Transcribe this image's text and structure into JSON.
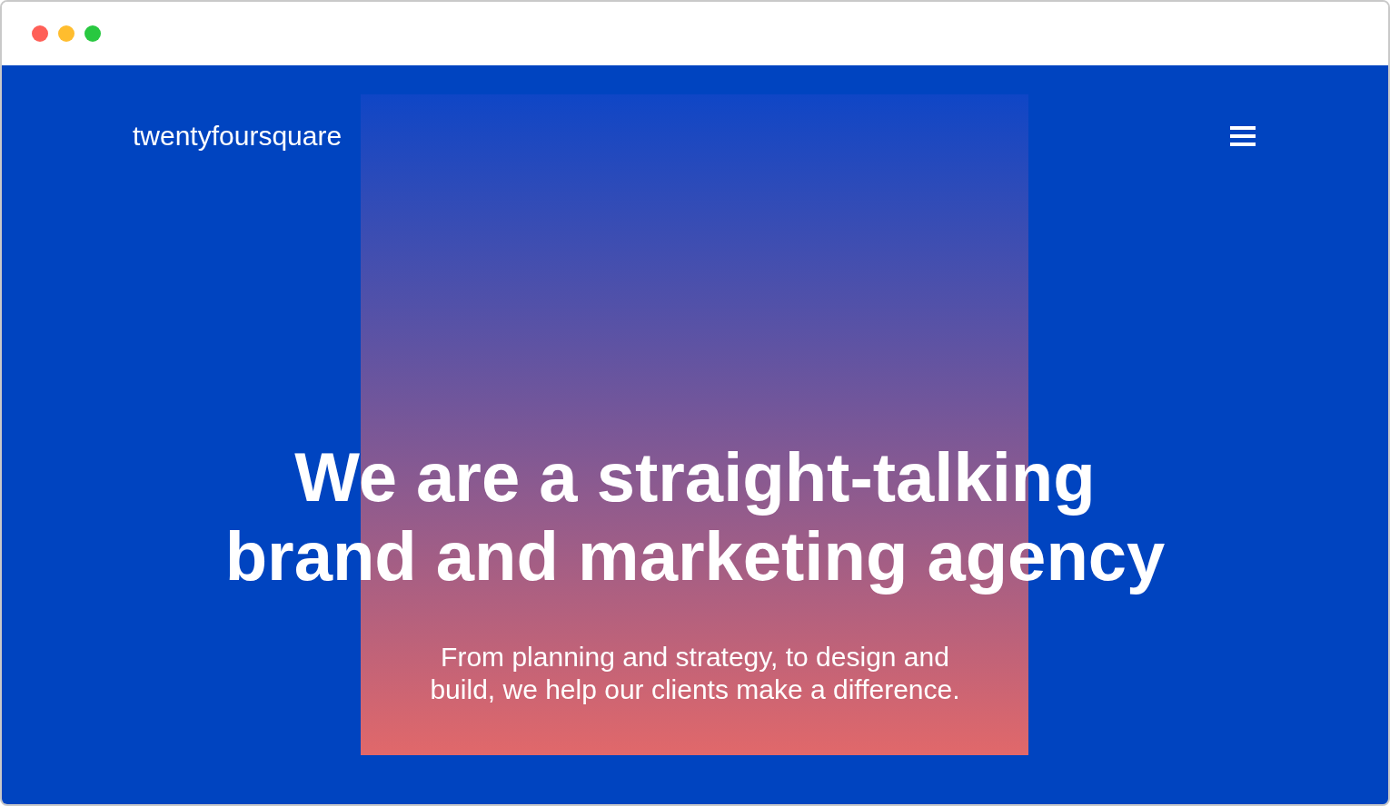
{
  "window": {
    "controls": [
      {
        "color": "#ff5f57"
      },
      {
        "color": "#ffbd2e"
      },
      {
        "color": "#28c840"
      }
    ]
  },
  "header": {
    "logo": "twentyfoursquare"
  },
  "hero": {
    "headline": "We are a straight-talking brand and marketing agency",
    "subtitle": "From planning and strategy, to design and build, we help our clients make a difference."
  }
}
